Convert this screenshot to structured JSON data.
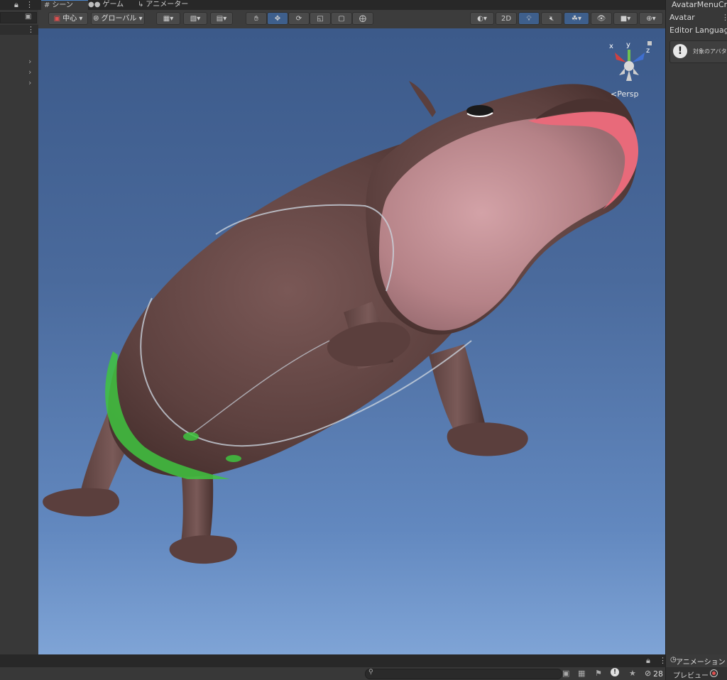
{
  "tabs": [
    {
      "label": "シーン",
      "icon": "hash-icon"
    },
    {
      "label": "ゲーム",
      "icon": "gamepad-icon"
    },
    {
      "label": "アニメーター",
      "icon": "animator-icon"
    }
  ],
  "toolbar": {
    "pivot_label": "中心",
    "space_label": "グローバル",
    "mode_2d_label": "2D"
  },
  "viewport": {
    "projection_label": "<Persp",
    "gizmo_axes": [
      "x",
      "y",
      "z"
    ]
  },
  "inspector": {
    "title": "AvatarMenuCr",
    "avatar_label": "Avatar",
    "editor_language_label": "Editor Languag",
    "help_message": "対象のアバタ"
  },
  "bottom": {
    "animation_tab_label": "アニメーション",
    "preview_label": "プレビュー",
    "hidden_count": "28"
  },
  "colors": {
    "accent": "#4b84c8",
    "panel": "#383838",
    "toolbar": "#3c3c3c",
    "sky_top": "#3c5a8a",
    "sky_bottom": "#7fa4d6",
    "hippo_body": "#6b4c4a",
    "hippo_snout": "#c8959a",
    "mouth": "#e86a7a",
    "collider_green": "#3fc43f"
  }
}
